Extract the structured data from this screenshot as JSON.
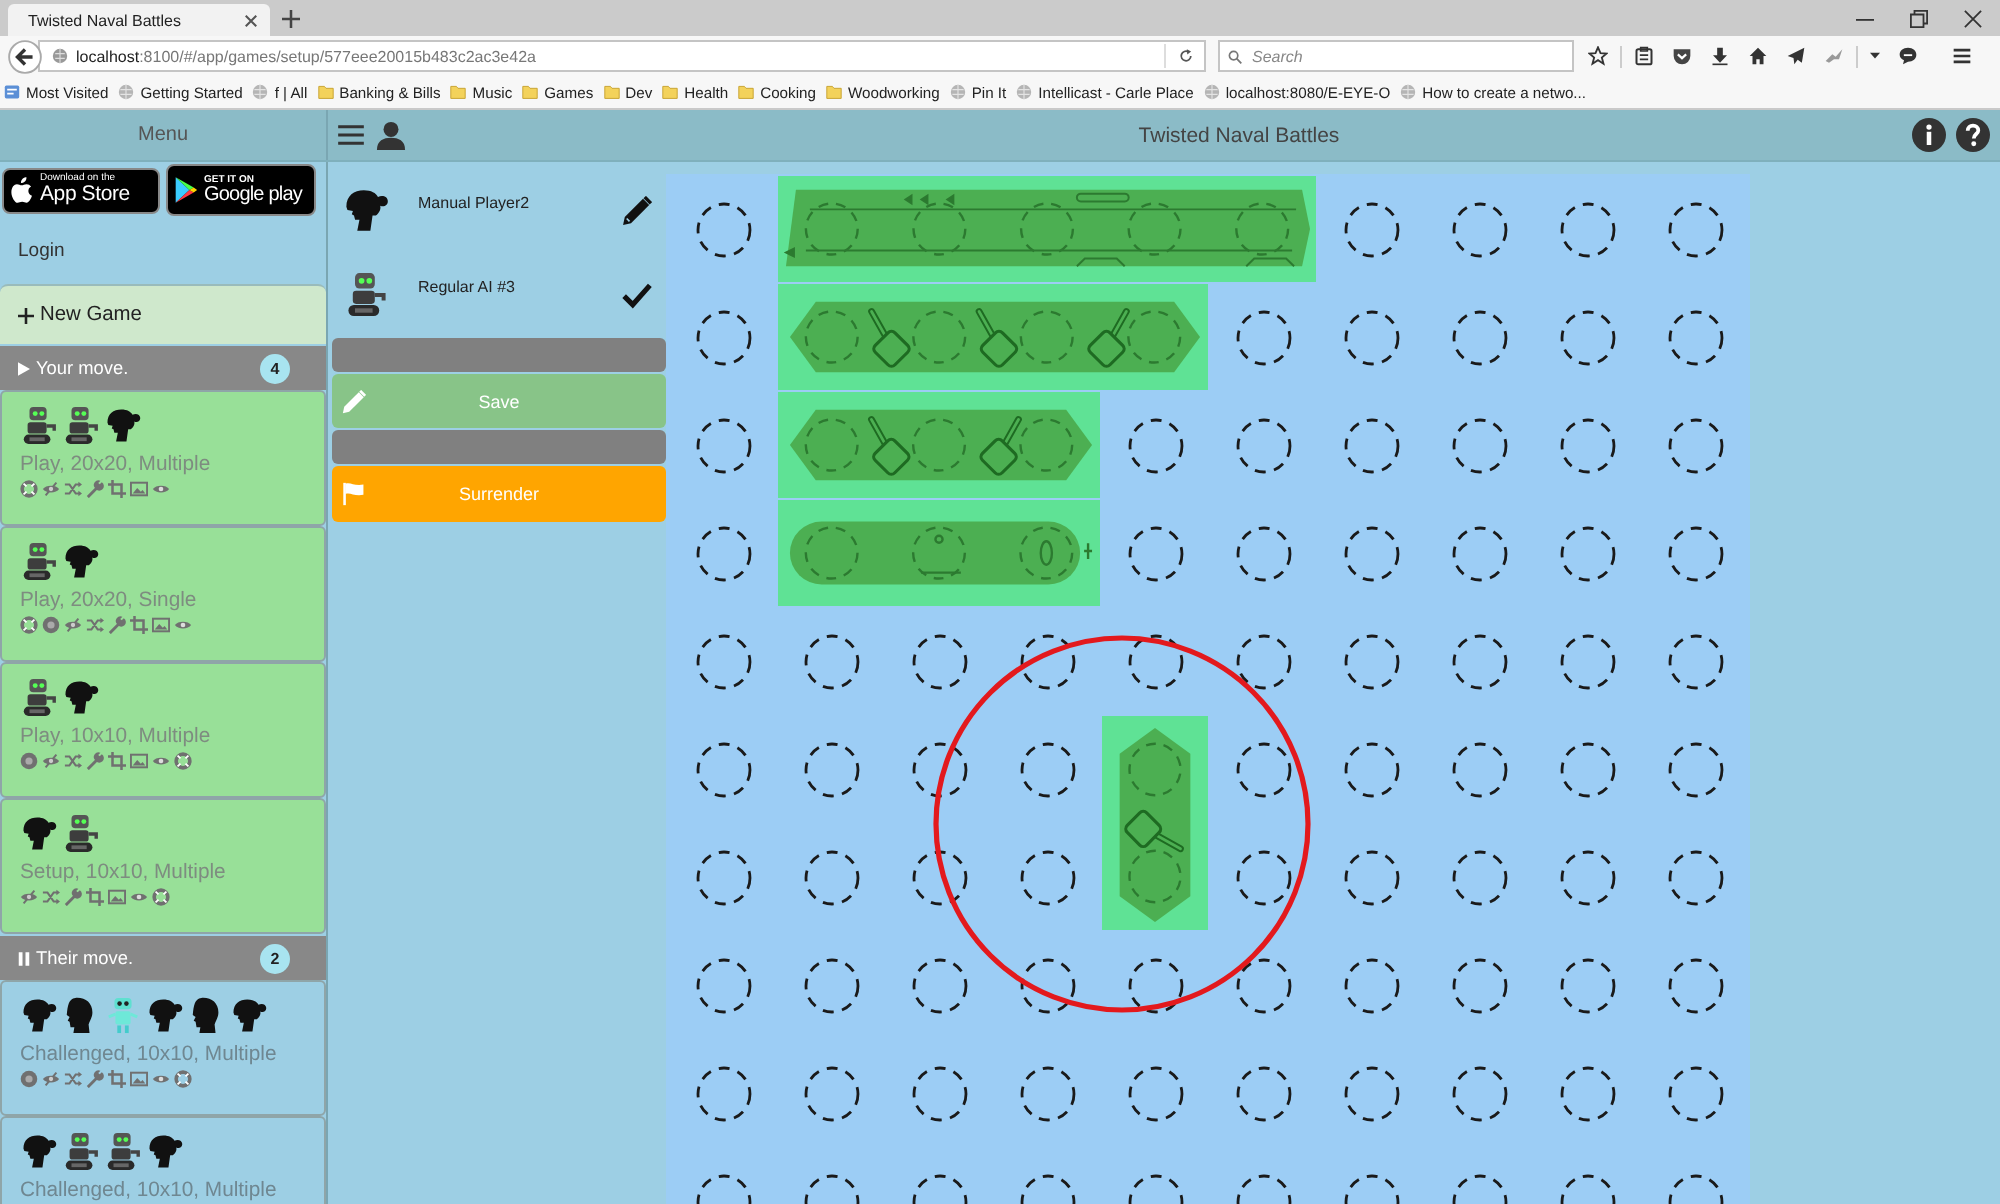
{
  "browser": {
    "tab": {
      "title": "Twisted Naval Battles"
    },
    "address": {
      "host": "localhost",
      "path": ":8100/#/app/games/setup/577eee20015b483c2ac3e42a"
    },
    "search": {
      "placeholder": "Search"
    },
    "bookmarks": [
      {
        "label": "Most Visited",
        "kind": "smart"
      },
      {
        "label": "Getting Started",
        "kind": "page"
      },
      {
        "label": "f | All",
        "kind": "page"
      },
      {
        "label": "Banking & Bills",
        "kind": "folder"
      },
      {
        "label": "Music",
        "kind": "folder"
      },
      {
        "label": "Games",
        "kind": "folder"
      },
      {
        "label": "Dev",
        "kind": "folder"
      },
      {
        "label": "Health",
        "kind": "folder"
      },
      {
        "label": "Cooking",
        "kind": "folder"
      },
      {
        "label": "Woodworking",
        "kind": "folder"
      },
      {
        "label": "Pin It",
        "kind": "page"
      },
      {
        "label": "Intellicast - Carle Place",
        "kind": "page"
      },
      {
        "label": "localhost:8080/E-EYE-O",
        "kind": "page"
      },
      {
        "label": "How to create a netwo...",
        "kind": "page"
      }
    ]
  },
  "menu": {
    "title": "Menu",
    "store_badges": [
      {
        "kind": "apple",
        "small": "Download on the",
        "large": "App Store"
      },
      {
        "kind": "google",
        "small": "GET IT ON",
        "large": "Google play"
      }
    ],
    "login": "Login",
    "new_game": "New Game",
    "sections": [
      {
        "kind": "yours",
        "title": "Your move.",
        "count": "4",
        "games": [
          {
            "players": [
              {
                "kind": "robot"
              },
              {
                "kind": "robot"
              },
              {
                "kind": "woman"
              }
            ],
            "title": "Play, 20x20, Multiple",
            "options": [
              {
                "kind": "lifebuoy"
              },
              {
                "kind": "hidden"
              },
              {
                "kind": "shuffle"
              },
              {
                "kind": "wrench"
              },
              {
                "kind": "crop"
              },
              {
                "kind": "picture"
              },
              {
                "kind": "eye"
              }
            ]
          },
          {
            "players": [
              {
                "kind": "robot"
              },
              {
                "kind": "woman"
              }
            ],
            "title": "Play, 20x20, Single",
            "options": [
              {
                "kind": "lifebuoy"
              },
              {
                "kind": "target"
              },
              {
                "kind": "hidden"
              },
              {
                "kind": "shuffle"
              },
              {
                "kind": "wrench"
              },
              {
                "kind": "crop"
              },
              {
                "kind": "picture"
              },
              {
                "kind": "eye"
              }
            ]
          },
          {
            "players": [
              {
                "kind": "robot"
              },
              {
                "kind": "woman"
              }
            ],
            "title": "Play, 10x10, Multiple",
            "options": [
              {
                "kind": "target"
              },
              {
                "kind": "hidden"
              },
              {
                "kind": "shuffle"
              },
              {
                "kind": "wrench"
              },
              {
                "kind": "crop"
              },
              {
                "kind": "picture"
              },
              {
                "kind": "eye"
              },
              {
                "kind": "lifebuoy"
              }
            ]
          },
          {
            "players": [
              {
                "kind": "woman"
              },
              {
                "kind": "robot"
              }
            ],
            "title": "Setup, 10x10, Multiple",
            "options": [
              {
                "kind": "hidden"
              },
              {
                "kind": "shuffle"
              },
              {
                "kind": "wrench"
              },
              {
                "kind": "crop"
              },
              {
                "kind": "picture"
              },
              {
                "kind": "eye"
              },
              {
                "kind": "lifebuoy"
              }
            ]
          }
        ]
      },
      {
        "kind": "theirs",
        "title": "Their move.",
        "count": "2",
        "games": [
          {
            "players": [
              {
                "kind": "woman"
              },
              {
                "kind": "man"
              },
              {
                "kind": "droid"
              },
              {
                "kind": "woman"
              },
              {
                "kind": "man"
              },
              {
                "kind": "woman"
              }
            ],
            "title": "Challenged, 10x10, Multiple",
            "options": [
              {
                "kind": "target"
              },
              {
                "kind": "hidden"
              },
              {
                "kind": "shuffle"
              },
              {
                "kind": "wrench"
              },
              {
                "kind": "crop"
              },
              {
                "kind": "picture"
              },
              {
                "kind": "eye"
              },
              {
                "kind": "lifebuoy"
              }
            ]
          },
          {
            "players": [
              {
                "kind": "woman"
              },
              {
                "kind": "robot"
              },
              {
                "kind": "robot"
              },
              {
                "kind": "woman"
              }
            ],
            "title": "Challenged, 10x10, Multiple"
          }
        ]
      }
    ]
  },
  "header": {
    "title": "Twisted Naval Battles"
  },
  "setup": {
    "players": [
      {
        "name": "Manual Player2",
        "kind": "woman",
        "ready": false
      },
      {
        "name": "Regular AI #3",
        "kind": "robot",
        "ready": true
      }
    ],
    "actions": [
      {
        "kind": "blank"
      },
      {
        "kind": "save",
        "label": "Save"
      },
      {
        "kind": "blank"
      },
      {
        "kind": "surrender",
        "label": "Surrender"
      }
    ]
  },
  "board": {
    "rows": [
      {
        "cells": [
          {
            "kind": "water"
          },
          {
            "kind": "carrier",
            "circled": false
          },
          {
            "kind": "carrier",
            "circled": false
          },
          {
            "kind": "carrier",
            "circled": false
          },
          {
            "kind": "carrier",
            "circled": false
          },
          {
            "kind": "carrier",
            "circled": false
          },
          {
            "kind": "water"
          },
          {
            "kind": "water"
          },
          {
            "kind": "water"
          },
          {
            "kind": "water"
          }
        ]
      },
      {
        "cells": [
          {
            "kind": "water"
          },
          {
            "kind": "battleship",
            "circled": false
          },
          {
            "kind": "battleship",
            "circled": false
          },
          {
            "kind": "battleship",
            "circled": false
          },
          {
            "kind": "battleship",
            "circled": false
          },
          {
            "kind": "water"
          },
          {
            "kind": "water"
          },
          {
            "kind": "water"
          },
          {
            "kind": "water"
          },
          {
            "kind": "water"
          }
        ]
      },
      {
        "cells": [
          {
            "kind": "water"
          },
          {
            "kind": "cruiser",
            "circled": false
          },
          {
            "kind": "cruiser",
            "circled": false
          },
          {
            "kind": "cruiser",
            "circled": false
          },
          {
            "kind": "water"
          },
          {
            "kind": "water"
          },
          {
            "kind": "water"
          },
          {
            "kind": "water"
          },
          {
            "kind": "water"
          },
          {
            "kind": "water"
          }
        ]
      },
      {
        "cells": [
          {
            "kind": "water"
          },
          {
            "kind": "submarine",
            "circled": false
          },
          {
            "kind": "submarine",
            "circled": false
          },
          {
            "kind": "submarine",
            "circled": false
          },
          {
            "kind": "water"
          },
          {
            "kind": "water"
          },
          {
            "kind": "water"
          },
          {
            "kind": "water"
          },
          {
            "kind": "water"
          },
          {
            "kind": "water"
          }
        ]
      },
      {
        "cells": [
          {
            "kind": "water"
          },
          {
            "kind": "water"
          },
          {
            "kind": "water"
          },
          {
            "kind": "water"
          },
          {
            "kind": "water"
          },
          {
            "kind": "water"
          },
          {
            "kind": "water"
          },
          {
            "kind": "water"
          },
          {
            "kind": "water"
          },
          {
            "kind": "water"
          }
        ]
      },
      {
        "cells": [
          {
            "kind": "water"
          },
          {
            "kind": "water"
          },
          {
            "kind": "water"
          },
          {
            "kind": "water"
          },
          {
            "kind": "destroyer",
            "circled": true
          },
          {
            "kind": "water"
          },
          {
            "kind": "water"
          },
          {
            "kind": "water"
          },
          {
            "kind": "water"
          },
          {
            "kind": "water"
          }
        ]
      },
      {
        "cells": [
          {
            "kind": "water"
          },
          {
            "kind": "water"
          },
          {
            "kind": "water"
          },
          {
            "kind": "water"
          },
          {
            "kind": "destroyer",
            "circled": true
          },
          {
            "kind": "water"
          },
          {
            "kind": "water"
          },
          {
            "kind": "water"
          },
          {
            "kind": "water"
          },
          {
            "kind": "water"
          }
        ]
      },
      {
        "cells": [
          {
            "kind": "water"
          },
          {
            "kind": "water"
          },
          {
            "kind": "water"
          },
          {
            "kind": "water"
          },
          {
            "kind": "water"
          },
          {
            "kind": "water"
          },
          {
            "kind": "water"
          },
          {
            "kind": "water"
          },
          {
            "kind": "water"
          },
          {
            "kind": "water"
          }
        ]
      },
      {
        "cells": [
          {
            "kind": "water"
          },
          {
            "kind": "water"
          },
          {
            "kind": "water"
          },
          {
            "kind": "water"
          },
          {
            "kind": "water"
          },
          {
            "kind": "water"
          },
          {
            "kind": "water"
          },
          {
            "kind": "water"
          },
          {
            "kind": "water"
          },
          {
            "kind": "water"
          }
        ]
      },
      {
        "cells": [
          {
            "kind": "water"
          },
          {
            "kind": "water"
          },
          {
            "kind": "water"
          },
          {
            "kind": "water"
          },
          {
            "kind": "water"
          },
          {
            "kind": "water"
          },
          {
            "kind": "water"
          },
          {
            "kind": "water"
          },
          {
            "kind": "water"
          },
          {
            "kind": "water"
          }
        ]
      }
    ]
  }
}
